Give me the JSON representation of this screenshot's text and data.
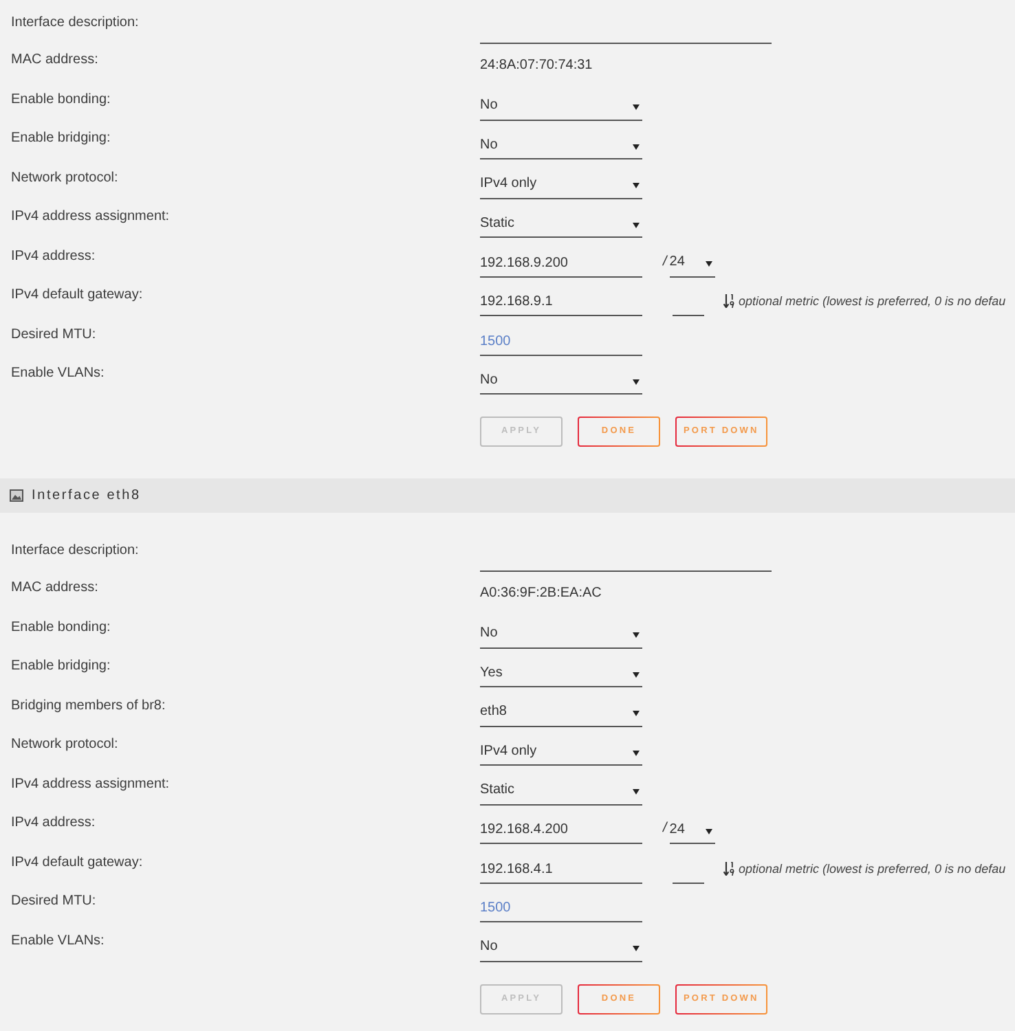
{
  "interfaces": [
    {
      "fields": [
        {
          "kind": "input",
          "label": "Interface description:"
        },
        {
          "kind": "static",
          "label": "MAC address:",
          "value": "24:8A:07:70:74:31"
        },
        {
          "kind": "select",
          "label": "Enable bonding:",
          "value": "No"
        },
        {
          "kind": "select",
          "label": "Enable bridging:",
          "value": "No"
        },
        {
          "kind": "select",
          "label": "Network protocol:",
          "value": "IPv4 only"
        },
        {
          "kind": "select",
          "label": "IPv4 address assignment:",
          "value": "Static"
        },
        {
          "kind": "address",
          "label": "IPv4 address:",
          "value": "192.168.9.200",
          "separator": "/",
          "prefix": "24"
        },
        {
          "kind": "gateway",
          "label": "IPv4 default gateway:",
          "value": "192.168.9.1",
          "hint": "optional metric (lowest is preferred, 0 is no defau"
        },
        {
          "kind": "number",
          "label": "Desired MTU:",
          "placeholder": "1500"
        },
        {
          "kind": "select",
          "label": "Enable VLANs:",
          "value": "No"
        }
      ],
      "buttons": [
        {
          "label": "APPLY",
          "disabled": true
        },
        {
          "label": "DONE",
          "disabled": false
        },
        {
          "label": "PORT DOWN",
          "disabled": false
        }
      ]
    },
    {
      "header": {
        "title": "Interface eth8"
      },
      "fields": [
        {
          "kind": "input",
          "label": "Interface description:"
        },
        {
          "kind": "static",
          "label": "MAC address:",
          "value": "A0:36:9F:2B:EA:AC"
        },
        {
          "kind": "select",
          "label": "Enable bonding:",
          "value": "No"
        },
        {
          "kind": "select",
          "label": "Enable bridging:",
          "value": "Yes"
        },
        {
          "kind": "select",
          "label": "Bridging members of br8:",
          "value": "eth8"
        },
        {
          "kind": "select",
          "label": "Network protocol:",
          "value": "IPv4 only"
        },
        {
          "kind": "select",
          "label": "IPv4 address assignment:",
          "value": "Static"
        },
        {
          "kind": "address",
          "label": "IPv4 address:",
          "value": "192.168.4.200",
          "separator": "/",
          "prefix": "24"
        },
        {
          "kind": "gateway",
          "label": "IPv4 default gateway:",
          "value": "192.168.4.1",
          "hint": "optional metric (lowest is preferred, 0 is no defau"
        },
        {
          "kind": "number",
          "label": "Desired MTU:",
          "placeholder": "1500"
        },
        {
          "kind": "select",
          "label": "Enable VLANs:",
          "value": "No"
        }
      ],
      "buttons": [
        {
          "label": "APPLY",
          "disabled": true
        },
        {
          "label": "DONE",
          "disabled": false
        },
        {
          "label": "PORT DOWN",
          "disabled": false
        }
      ]
    }
  ]
}
